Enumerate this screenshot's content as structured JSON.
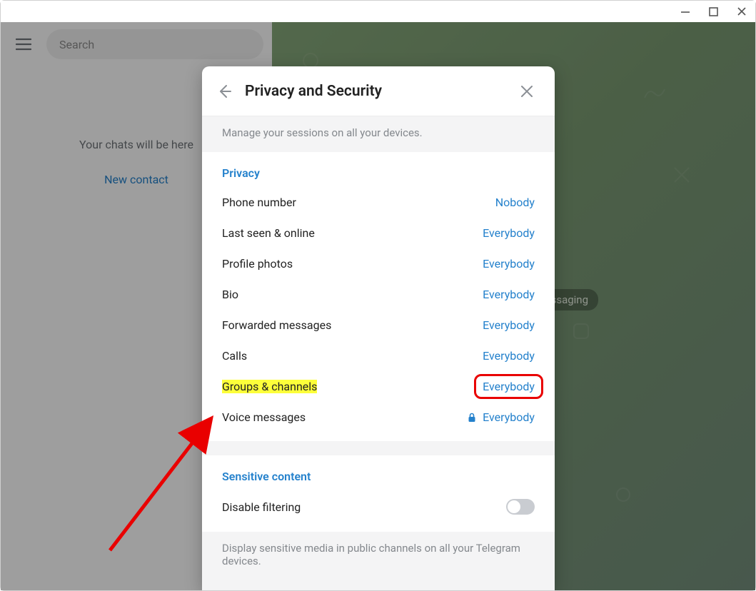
{
  "window_controls": {
    "minimize": "minimize-icon",
    "maximize": "maximize-icon",
    "close": "close-icon"
  },
  "sidebar": {
    "search_placeholder": "Search",
    "empty_text": "Your chats will be here",
    "new_contact": "New contact"
  },
  "chat_badge": "essaging",
  "modal": {
    "title": "Privacy and Security",
    "sessions_desc": "Manage your sessions on all your devices.",
    "privacy_heading": "Privacy",
    "rows": [
      {
        "label": "Phone number",
        "value": "Nobody"
      },
      {
        "label": "Last seen & online",
        "value": "Everybody"
      },
      {
        "label": "Profile photos",
        "value": "Everybody"
      },
      {
        "label": "Bio",
        "value": "Everybody"
      },
      {
        "label": "Forwarded messages",
        "value": "Everybody"
      },
      {
        "label": "Calls",
        "value": "Everybody"
      },
      {
        "label": "Groups & channels",
        "value": "Everybody"
      },
      {
        "label": "Voice messages",
        "value": "Everybody",
        "locked": true
      }
    ],
    "sensitive_heading": "Sensitive content",
    "disable_filtering": "Disable filtering",
    "sensitive_desc": "Display sensitive media in public channels on all your Telegram devices."
  }
}
